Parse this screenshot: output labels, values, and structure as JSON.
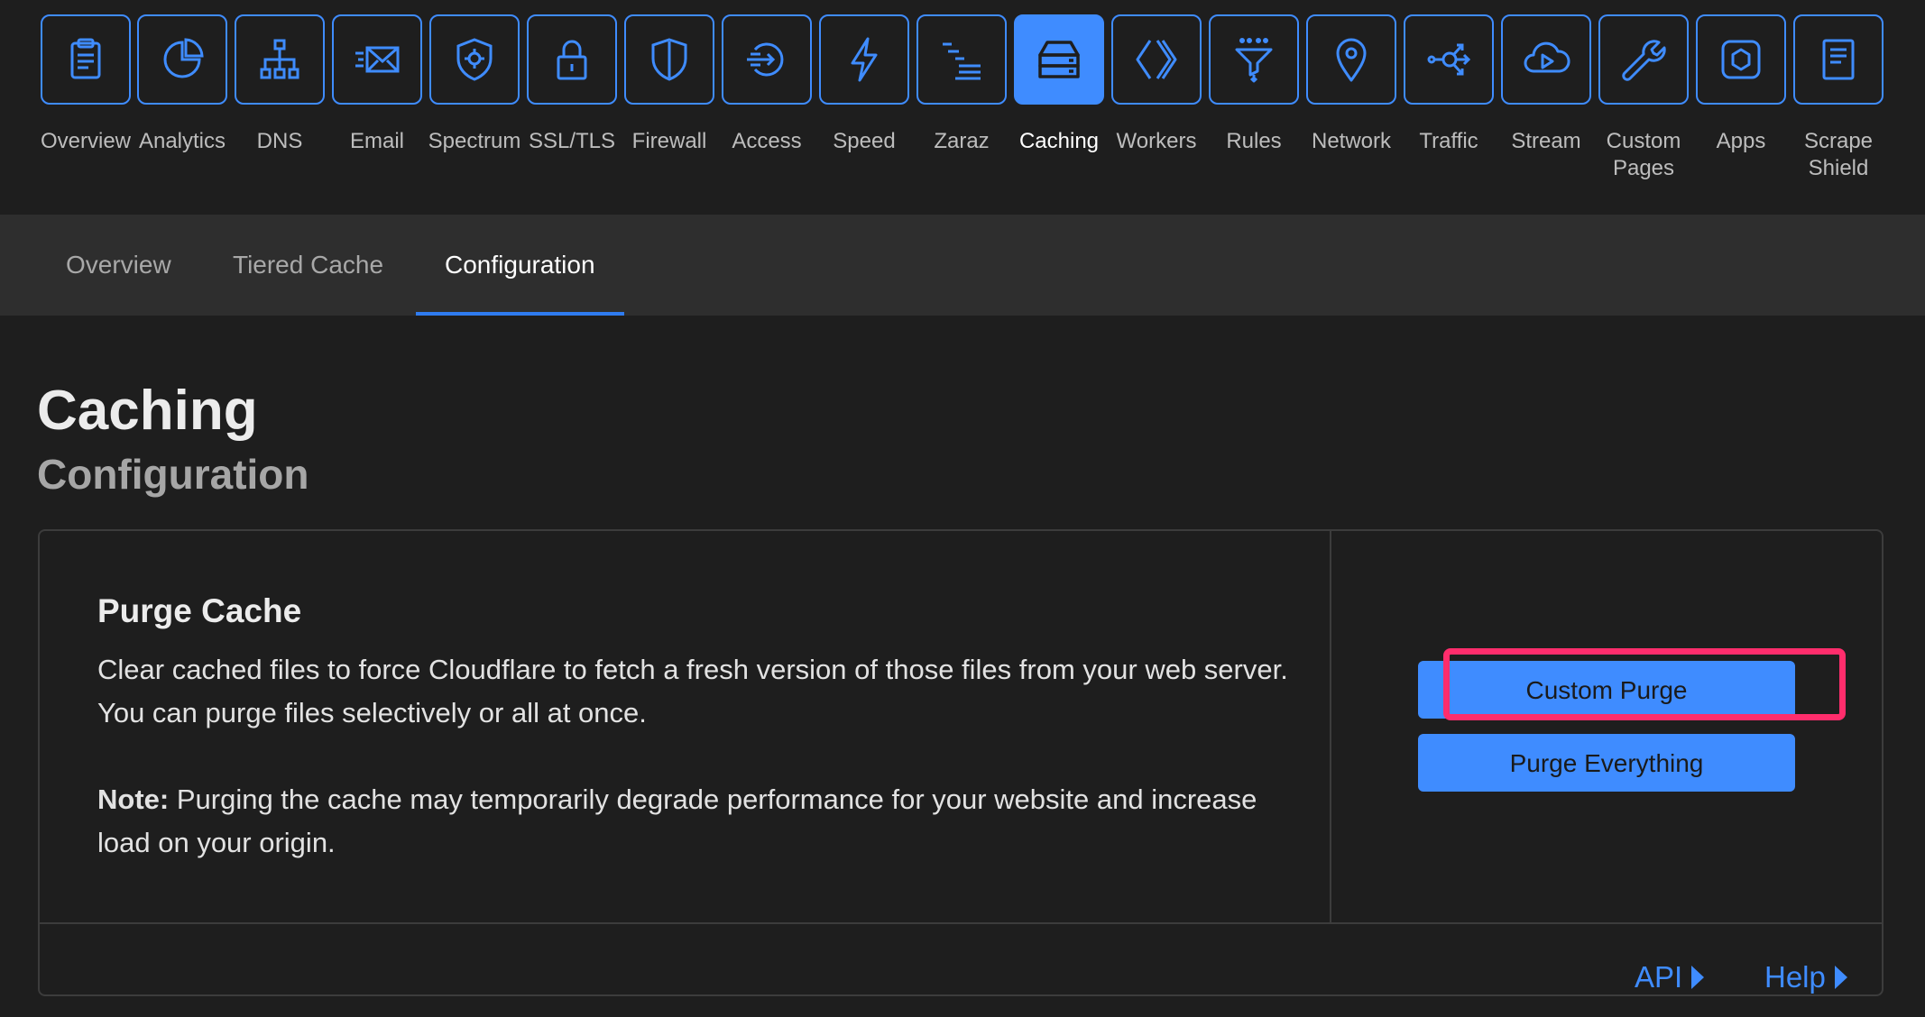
{
  "topnav": {
    "items": [
      {
        "label": "Overview",
        "icon": "clipboard-icon"
      },
      {
        "label": "Analytics",
        "icon": "pie-chart-icon"
      },
      {
        "label": "DNS",
        "icon": "network-tree-icon"
      },
      {
        "label": "Email",
        "icon": "envelope-icon"
      },
      {
        "label": "Spectrum",
        "icon": "shield-gear-icon"
      },
      {
        "label": "SSL/TLS",
        "icon": "lock-icon"
      },
      {
        "label": "Firewall",
        "icon": "shield-icon"
      },
      {
        "label": "Access",
        "icon": "login-arrow-icon"
      },
      {
        "label": "Speed",
        "icon": "lightning-icon"
      },
      {
        "label": "Zaraz",
        "icon": "stairs-lines-icon"
      },
      {
        "label": "Caching",
        "icon": "server-stack-icon"
      },
      {
        "label": "Workers",
        "icon": "brackets-icon"
      },
      {
        "label": "Rules",
        "icon": "funnel-icon"
      },
      {
        "label": "Network",
        "icon": "location-pin-icon"
      },
      {
        "label": "Traffic",
        "icon": "share-arrows-icon"
      },
      {
        "label": "Stream",
        "icon": "cloud-play-icon"
      },
      {
        "label": "Custom\nPages",
        "icon": "wrench-icon"
      },
      {
        "label": "Apps",
        "icon": "hexagon-icon"
      },
      {
        "label": "Scrape\nShield",
        "icon": "document-icon"
      }
    ],
    "active": "Caching"
  },
  "subtabs": {
    "items": [
      "Overview",
      "Tiered Cache",
      "Configuration"
    ],
    "active": "Configuration"
  },
  "page": {
    "title": "Caching",
    "subtitle": "Configuration"
  },
  "purge_card": {
    "heading": "Purge Cache",
    "description": "Clear cached files to force Cloudflare to fetch a fresh version of those files from your web server. You can purge files selectively or all at once.",
    "note_label": "Note:",
    "note_text": " Purging the cache may temporarily degrade performance for your website and increase load on your origin.",
    "custom_purge_label": "Custom Purge",
    "purge_everything_label": "Purge Everything",
    "api_link": "API",
    "help_link": "Help"
  },
  "colors": {
    "accent": "#3f8cff",
    "highlight": "#ff2d6c",
    "background": "#1e1e1e",
    "subnav_background": "#2e2e2e"
  }
}
